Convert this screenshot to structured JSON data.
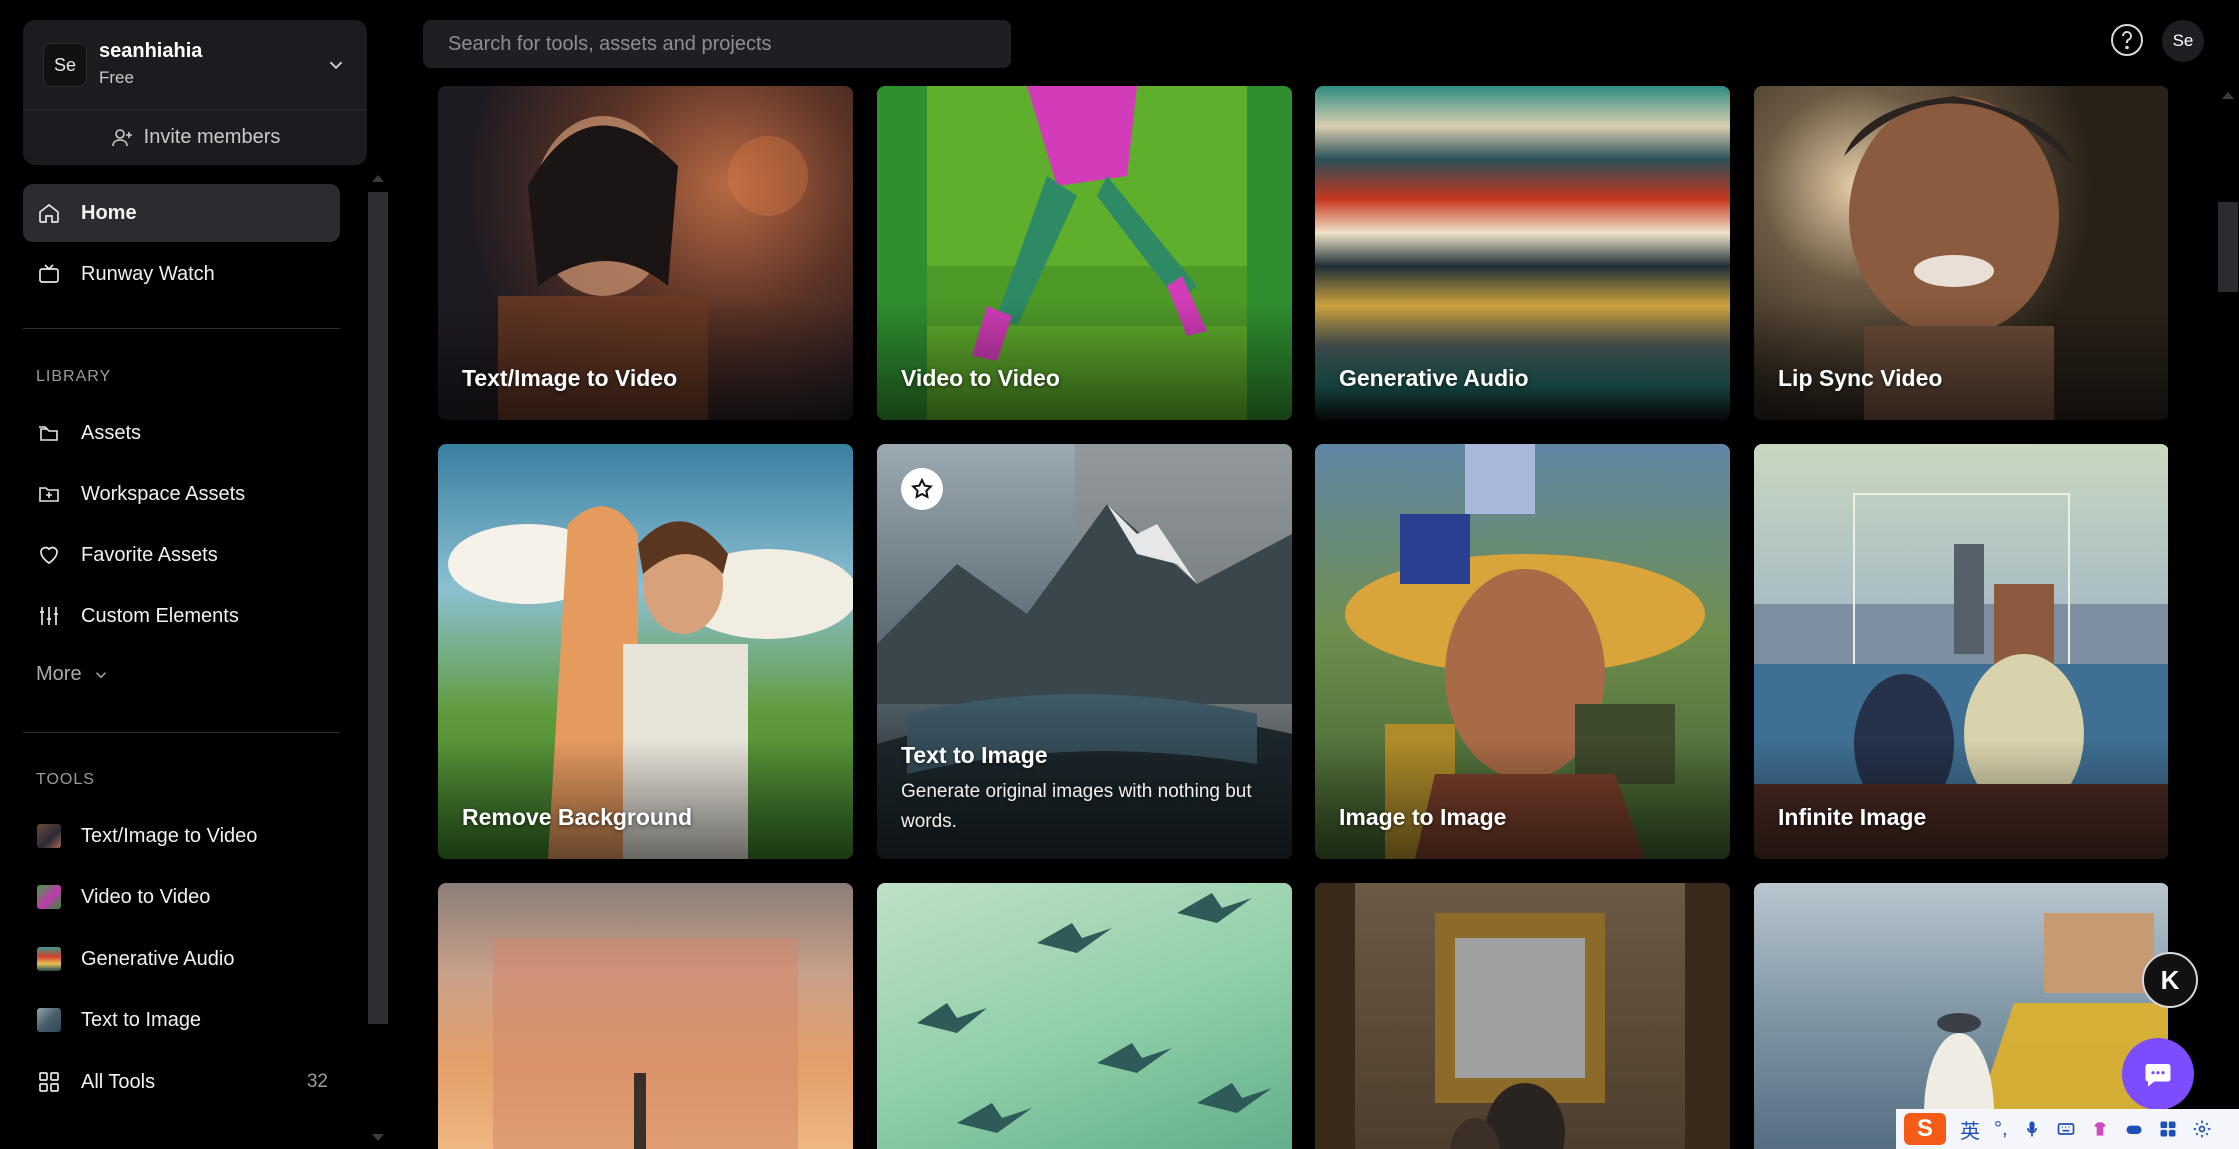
{
  "workspace": {
    "avatar_initials": "Se",
    "name": "seanhiahia",
    "plan": "Free",
    "invite_label": "Invite members"
  },
  "nav": {
    "home": "Home",
    "runway_watch": "Runway Watch"
  },
  "library": {
    "heading": "LIBRARY",
    "items": [
      {
        "label": "Assets",
        "icon": "folders-icon"
      },
      {
        "label": "Workspace Assets",
        "icon": "workspace-folder-icon"
      },
      {
        "label": "Favorite Assets",
        "icon": "heart-icon"
      },
      {
        "label": "Custom Elements",
        "icon": "sliders-icon"
      }
    ],
    "more_label": "More"
  },
  "tools": {
    "heading": "TOOLS",
    "items": [
      {
        "label": "Text/Image to Video"
      },
      {
        "label": "Video to Video"
      },
      {
        "label": "Generative Audio"
      },
      {
        "label": "Text to Image"
      }
    ],
    "all_tools_label": "All Tools",
    "all_tools_count": "32"
  },
  "search": {
    "placeholder": "Search for tools, assets and projects"
  },
  "header": {
    "user_initials": "Se"
  },
  "cards": {
    "row1": [
      "Text/Image to Video",
      "Video to Video",
      "Generative Audio",
      "Lip Sync Video"
    ],
    "row2": [
      "Remove Background",
      "Text to Image",
      "Image to Image",
      "Infinite Image"
    ],
    "featured_desc": "Generate original images with nothing but words."
  },
  "floating": {
    "k_label": "K"
  },
  "ime": {
    "lang": "英",
    "punct": "°,"
  },
  "colors": {
    "accent_chat": "#7b4dff",
    "sidebar_active": "#2b2c30",
    "card_bg": "#1b1c1f"
  }
}
